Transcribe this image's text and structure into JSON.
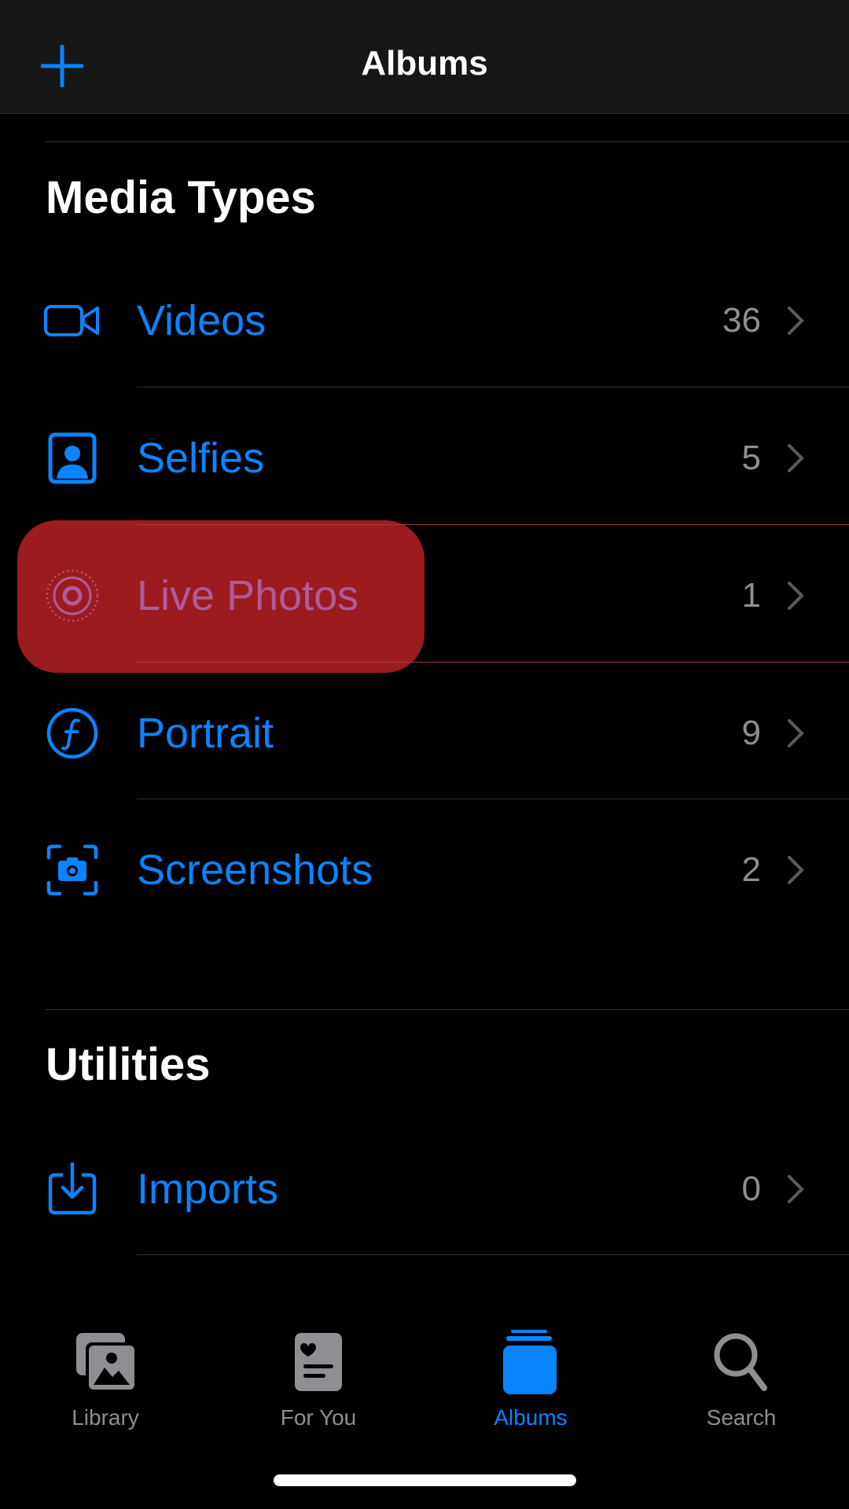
{
  "header": {
    "title": "Albums",
    "add_icon": "plus-icon"
  },
  "media_types": {
    "title": "Media Types",
    "items": [
      {
        "label": "Videos",
        "count": "36",
        "icon": "video-camera-icon"
      },
      {
        "label": "Selfies",
        "count": "5",
        "icon": "person-portrait-icon"
      },
      {
        "label": "Live Photos",
        "count": "1",
        "icon": "live-photo-icon"
      },
      {
        "label": "Portrait",
        "count": "9",
        "icon": "portrait-f-icon"
      },
      {
        "label": "Screenshots",
        "count": "2",
        "icon": "screenshot-camera-icon"
      }
    ]
  },
  "utilities": {
    "title": "Utilities",
    "items": [
      {
        "label": "Imports",
        "count": "0",
        "icon": "import-tray-icon"
      }
    ]
  },
  "tabbar": {
    "items": [
      {
        "label": "Library",
        "icon": "photo-library-icon",
        "active": false
      },
      {
        "label": "For You",
        "icon": "for-you-card-icon",
        "active": false
      },
      {
        "label": "Albums",
        "icon": "albums-stack-icon",
        "active": true
      },
      {
        "label": "Search",
        "icon": "magnifier-icon",
        "active": false
      }
    ]
  },
  "colors": {
    "accent": "#0a84ff",
    "highlight": "#9b1c1f",
    "secondary": "#8e8e93"
  }
}
